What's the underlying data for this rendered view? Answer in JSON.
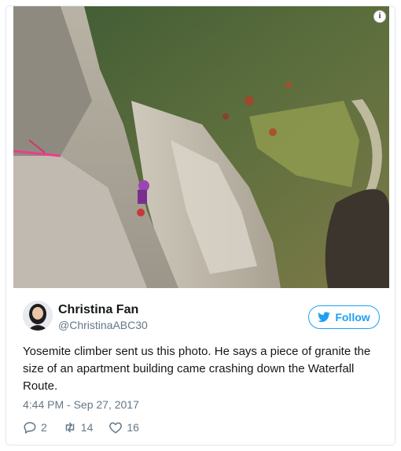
{
  "tweet": {
    "media_alt": "",
    "author": {
      "name": "Christina Fan",
      "handle": "@ChristinaABC30"
    },
    "follow_label": "Follow",
    "text": "Yosemite climber sent us this photo. He says a piece of granite the size of an apartment building came crashing down the Waterfall Route.",
    "timestamp": "4:44 PM - Sep 27, 2017",
    "stats": {
      "replies": "2",
      "retweets": "14",
      "likes": "16"
    }
  },
  "icons": {
    "info": "info-icon",
    "twitter": "twitter-bird-icon",
    "reply": "reply-icon",
    "retweet": "retweet-icon",
    "like": "heart-icon"
  },
  "colors": {
    "accent": "#1da1f2",
    "muted": "#657786",
    "text": "#14171a",
    "border": "#e1e8ed"
  }
}
